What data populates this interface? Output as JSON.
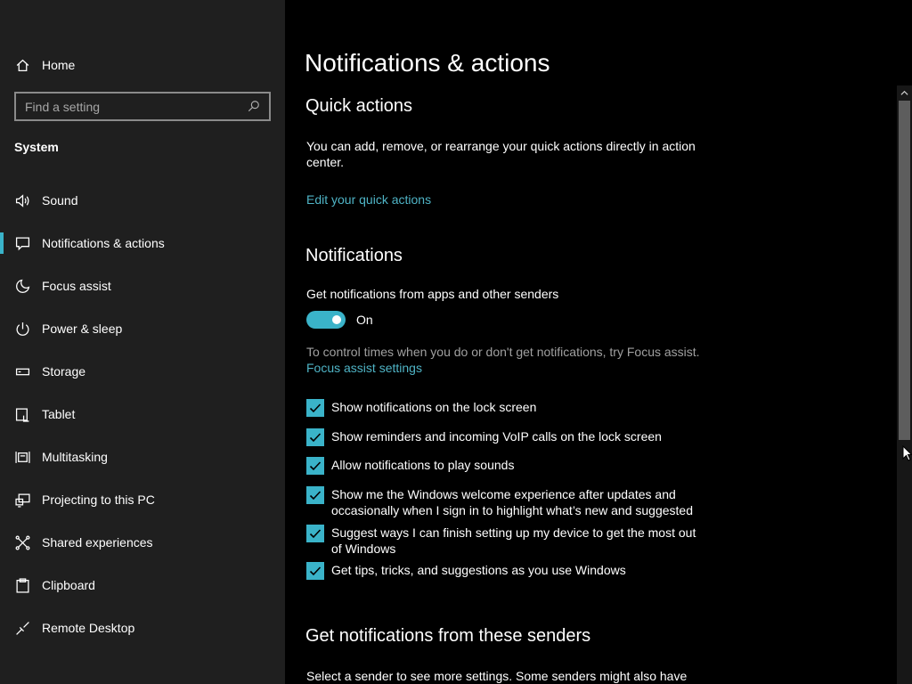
{
  "sidebar": {
    "home_label": "Home",
    "search_placeholder": "Find a setting",
    "section_title": "System",
    "items": [
      {
        "label": "Sound",
        "icon": "speaker-icon"
      },
      {
        "label": "Notifications & actions",
        "icon": "message-icon",
        "active": true
      },
      {
        "label": "Focus assist",
        "icon": "moon-icon"
      },
      {
        "label": "Power & sleep",
        "icon": "power-icon"
      },
      {
        "label": "Storage",
        "icon": "storage-icon"
      },
      {
        "label": "Tablet",
        "icon": "tablet-icon"
      },
      {
        "label": "Multitasking",
        "icon": "multitasking-icon"
      },
      {
        "label": "Projecting to this PC",
        "icon": "projecting-icon"
      },
      {
        "label": "Shared experiences",
        "icon": "shared-icon"
      },
      {
        "label": "Clipboard",
        "icon": "clipboard-icon"
      },
      {
        "label": "Remote Desktop",
        "icon": "remote-desktop-icon"
      }
    ]
  },
  "main": {
    "title": "Notifications & actions",
    "quick_actions": {
      "heading": "Quick actions",
      "description": "You can add, remove, or rearrange your quick actions directly in action center.",
      "link": "Edit your quick actions"
    },
    "notifications": {
      "heading": "Notifications",
      "get_label": "Get notifications from apps and other senders",
      "toggle_state": "On",
      "focus_text": "To control times when you do or don't get notifications, try Focus assist.",
      "focus_link": "Focus assist settings",
      "checkboxes": [
        {
          "label": "Show notifications on the lock screen",
          "checked": true
        },
        {
          "label": "Show reminders and incoming VoIP calls on the lock screen",
          "checked": true
        },
        {
          "label": "Allow notifications to play sounds",
          "checked": true
        },
        {
          "label": "Show me the Windows welcome experience after updates and occasionally when I sign in to highlight what’s new and suggested",
          "checked": true
        },
        {
          "label": "Suggest ways I can finish setting up my device to get the most out of Windows",
          "checked": true
        },
        {
          "label": "Get tips, tricks, and suggestions as you use Windows",
          "checked": true
        }
      ]
    },
    "senders": {
      "heading": "Get notifications from these senders",
      "description": "Select a sender to see more settings. Some senders might also have"
    }
  },
  "colors": {
    "accent": "#3ab3c9",
    "link": "#4fb4c6",
    "sidebar_bg": "#1f1f1f",
    "main_bg": "#000000"
  }
}
